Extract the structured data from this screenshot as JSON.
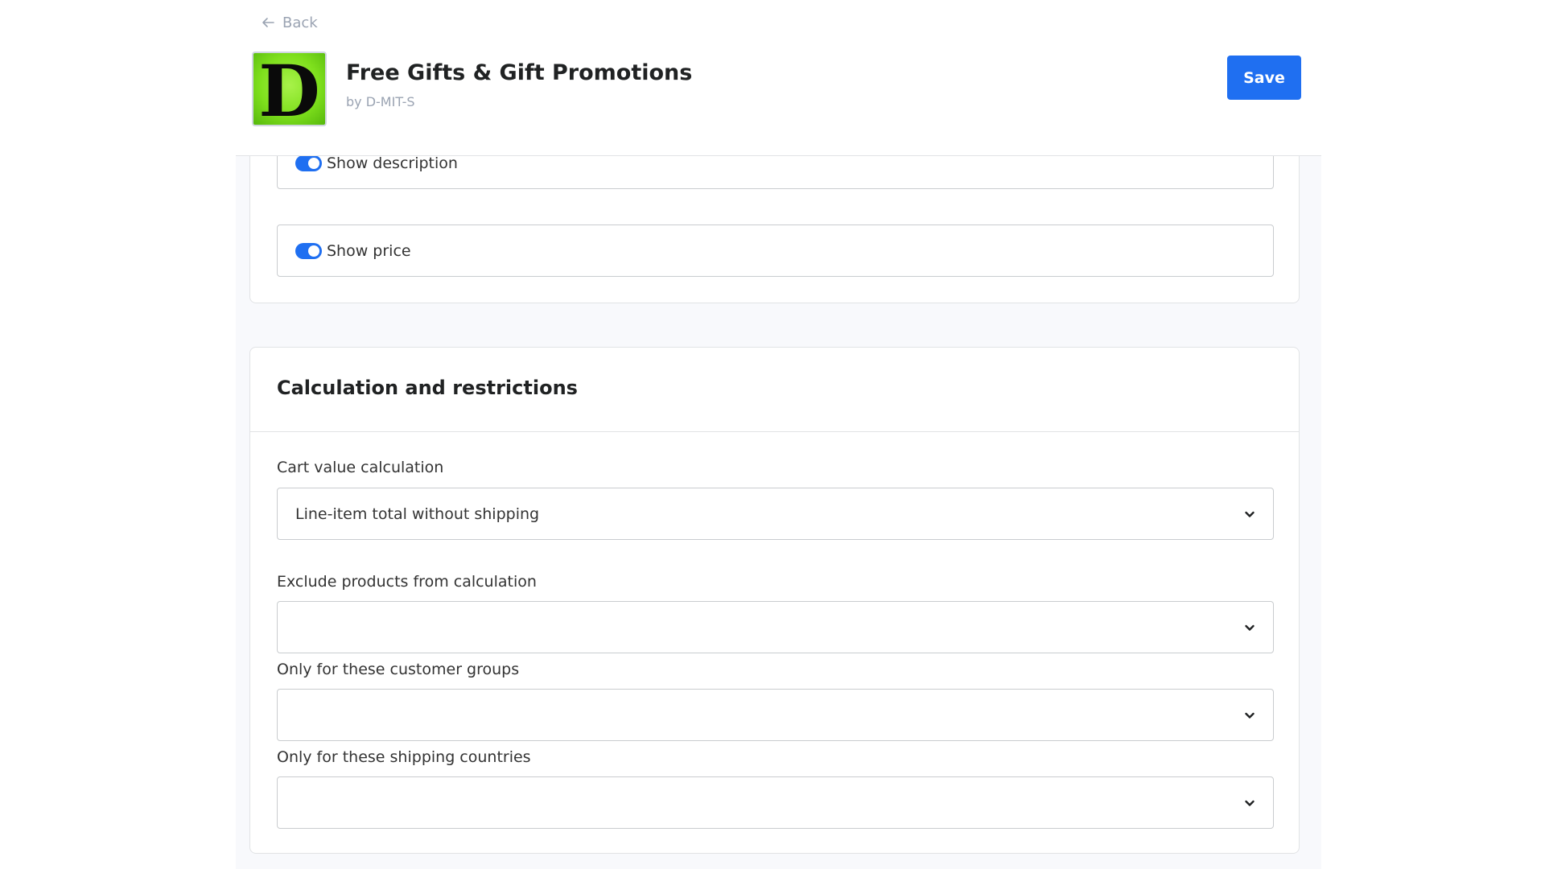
{
  "header": {
    "back_label": "Back",
    "app_logo_letter": "D",
    "app_title": "Free Gifts & Gift Promotions",
    "app_by": "by D-MIT-S",
    "save_label": "Save"
  },
  "display_options": {
    "toggles": [
      {
        "label": "Show description",
        "on": true
      },
      {
        "label": "Show price",
        "on": true
      }
    ]
  },
  "calculation": {
    "title": "Calculation and restrictions",
    "fields": [
      {
        "label": "Cart value calculation",
        "value": "Line-item total without shipping"
      },
      {
        "label": "Exclude products from calculation",
        "value": ""
      },
      {
        "label": "Only for these customer groups",
        "value": ""
      },
      {
        "label": "Only for these shipping countries",
        "value": ""
      }
    ]
  },
  "colors": {
    "accent": "#1f6ff1",
    "logo_green": "#7fe01d",
    "muted_text": "#9aa3b2"
  }
}
